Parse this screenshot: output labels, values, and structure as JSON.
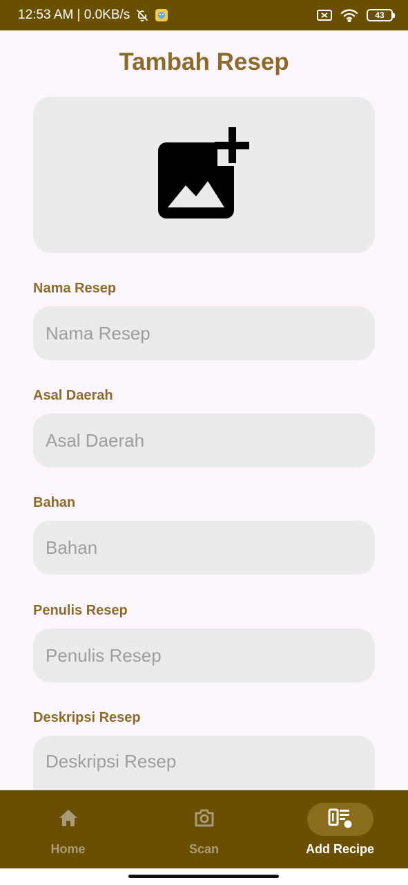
{
  "status_bar": {
    "time_speed": "12:53 AM | 0.0KB/s",
    "battery": "43"
  },
  "page": {
    "title": "Tambah Resep"
  },
  "form": {
    "image_picker": {
      "icon": "add-photo-icon"
    },
    "fields": [
      {
        "label": "Nama Resep",
        "placeholder": "Nama Resep",
        "value": ""
      },
      {
        "label": "Asal Daerah",
        "placeholder": "Asal Daerah",
        "value": ""
      },
      {
        "label": "Bahan",
        "placeholder": "Bahan",
        "value": ""
      },
      {
        "label": "Penulis Resep",
        "placeholder": "Penulis Resep",
        "value": ""
      },
      {
        "label": "Deskripsi Resep",
        "placeholder": "Deskripsi Resep",
        "value": ""
      }
    ]
  },
  "bottom_nav": {
    "items": [
      {
        "label": "Home",
        "icon": "home-icon",
        "active": false
      },
      {
        "label": "Scan",
        "icon": "camera-icon",
        "active": false
      },
      {
        "label": "Add Recipe",
        "icon": "add-recipe-icon",
        "active": true
      }
    ]
  },
  "colors": {
    "primary": "#6b4f00",
    "accent_text": "#8b6a2b",
    "input_bg": "#ebebeb",
    "background": "#fdf6fd",
    "nav_active_pill": "#8a6c1e"
  }
}
